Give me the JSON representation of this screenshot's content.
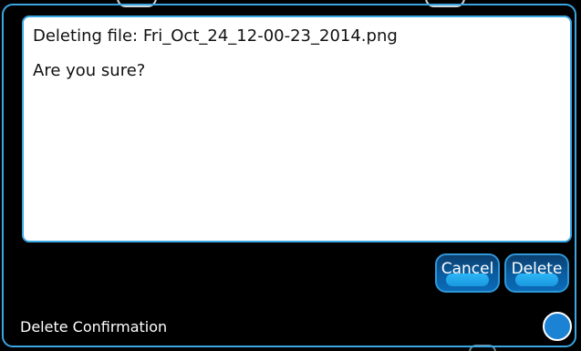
{
  "dialog": {
    "message_line1": "Deleting file: Fri_Oct_24_12-00-23_2014.png",
    "message_line2": "Are you sure?",
    "cancel_label": "Cancel",
    "delete_label": "Delete"
  },
  "status_bar": {
    "title": "Delete Confirmation",
    "indicator_icon": "status-circle-icon"
  },
  "colors": {
    "accent": "#3aa6e2",
    "button_fill": "#0a5ea3",
    "indicator": "#1b82d4",
    "background": "#000000"
  }
}
